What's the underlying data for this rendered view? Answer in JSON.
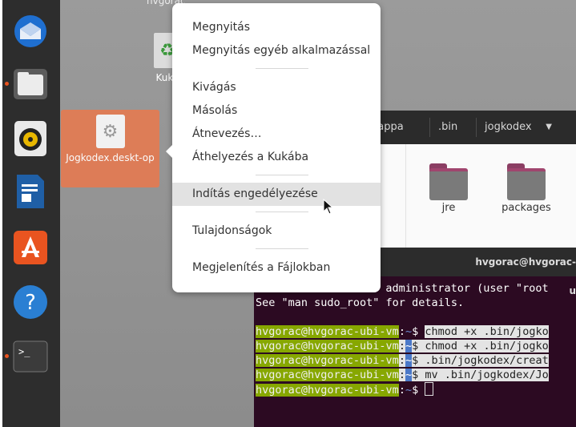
{
  "desktop": {
    "top_label": "hvgorac",
    "trash_label": "Kuka",
    "selected_file": "Jogkodex.deskt-op"
  },
  "dock": {
    "items": [
      "thunderbird-icon",
      "files-icon",
      "rhythmbox-icon",
      "writer-icon",
      "software-icon",
      "help-icon",
      "terminal-icon"
    ]
  },
  "files_window": {
    "breadcrumbs": [
      "nappa",
      ".bin",
      "jogkodex"
    ],
    "folders": [
      "jre",
      "packages"
    ]
  },
  "terminal": {
    "title": "hvgorac@hvgorac-u",
    "line1": "as administrator (user \"root",
    "line2": "See \"man sudo_root\" for details.",
    "user": "hvgorac@hvgorac-ubi-vm",
    "sep": ":",
    "path": "~",
    "dollar": "$",
    "cmd1": "chmod +x .bin/jogko",
    "cmd2": "chmod +x .bin/jogko",
    "cmd3": ".bin/jogkodex/creat",
    "cmd4": "mv .bin/jogkodex/Jo"
  },
  "context_menu": {
    "items": [
      "Megnyitás",
      "Megnyitás egyéb alkalmazással",
      "Kivágás",
      "Másolás",
      "Átnevezés…",
      "Áthelyezés a Kukába",
      "Indítás engedélyezése",
      "Tulajdonságok",
      "Megjelenítés a Fájlokban"
    ]
  },
  "colors": {
    "accent": "#e95420",
    "selection": "#e07c55",
    "terminal_bg": "#2c0a22"
  }
}
